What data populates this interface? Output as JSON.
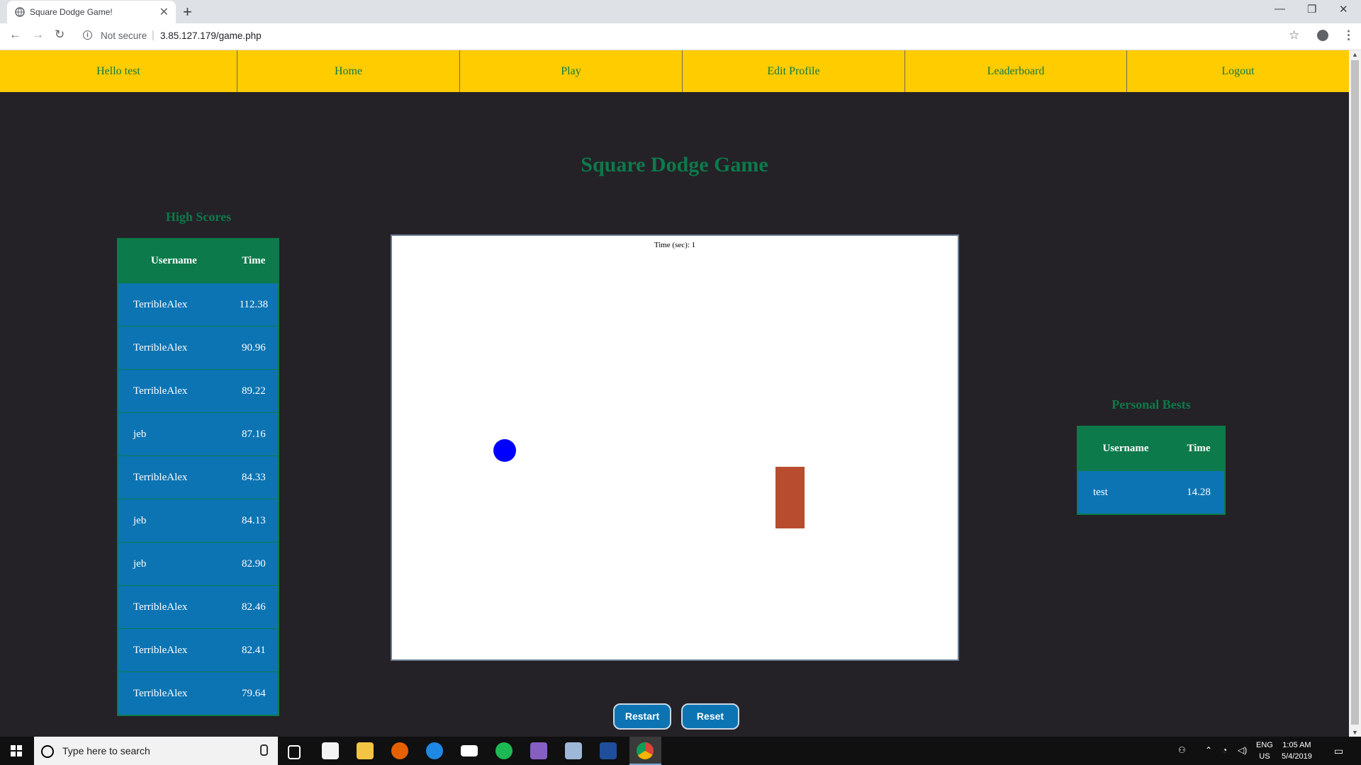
{
  "browser": {
    "tab_title": "Square Dodge Game!",
    "security_label": "Not secure",
    "url": "3.85.127.179/game.php"
  },
  "nav": {
    "greeting": "Hello test",
    "items": [
      "Home",
      "Play",
      "Edit Profile",
      "Leaderboard",
      "Logout"
    ]
  },
  "page": {
    "title": "Square Dodge Game"
  },
  "high_scores": {
    "title": "High Scores",
    "col_username": "Username",
    "col_time": "Time",
    "rows": [
      {
        "username": "TerribleAlex",
        "time": "112.38"
      },
      {
        "username": "TerribleAlex",
        "time": "90.96"
      },
      {
        "username": "TerribleAlex",
        "time": "89.22"
      },
      {
        "username": "jeb",
        "time": "87.16"
      },
      {
        "username": "TerribleAlex",
        "time": "84.33"
      },
      {
        "username": "jeb",
        "time": "84.13"
      },
      {
        "username": "jeb",
        "time": "82.90"
      },
      {
        "username": "TerribleAlex",
        "time": "82.46"
      },
      {
        "username": "TerribleAlex",
        "time": "82.41"
      },
      {
        "username": "TerribleAlex",
        "time": "79.64"
      }
    ]
  },
  "personal_bests": {
    "title": "Personal Bests",
    "col_username": "Username",
    "col_time": "Time",
    "rows": [
      {
        "username": "test",
        "time": "14.28"
      }
    ]
  },
  "game": {
    "timer_label": "Time (sec): 1",
    "player_color": "#0000ff",
    "obstacle_color": "#b84c2e"
  },
  "buttons": {
    "restart": "Restart",
    "reset": "Reset"
  },
  "taskbar": {
    "search_placeholder": "Type here to search",
    "lang_top": "ENG",
    "lang_bottom": "US",
    "time": "1:05 AM",
    "date": "5/4/2019"
  },
  "colors": {
    "nav_bg": "#ffcc00",
    "accent_green": "#0c7a4a",
    "table_blue": "#0c74b3",
    "page_bg": "#242127"
  }
}
